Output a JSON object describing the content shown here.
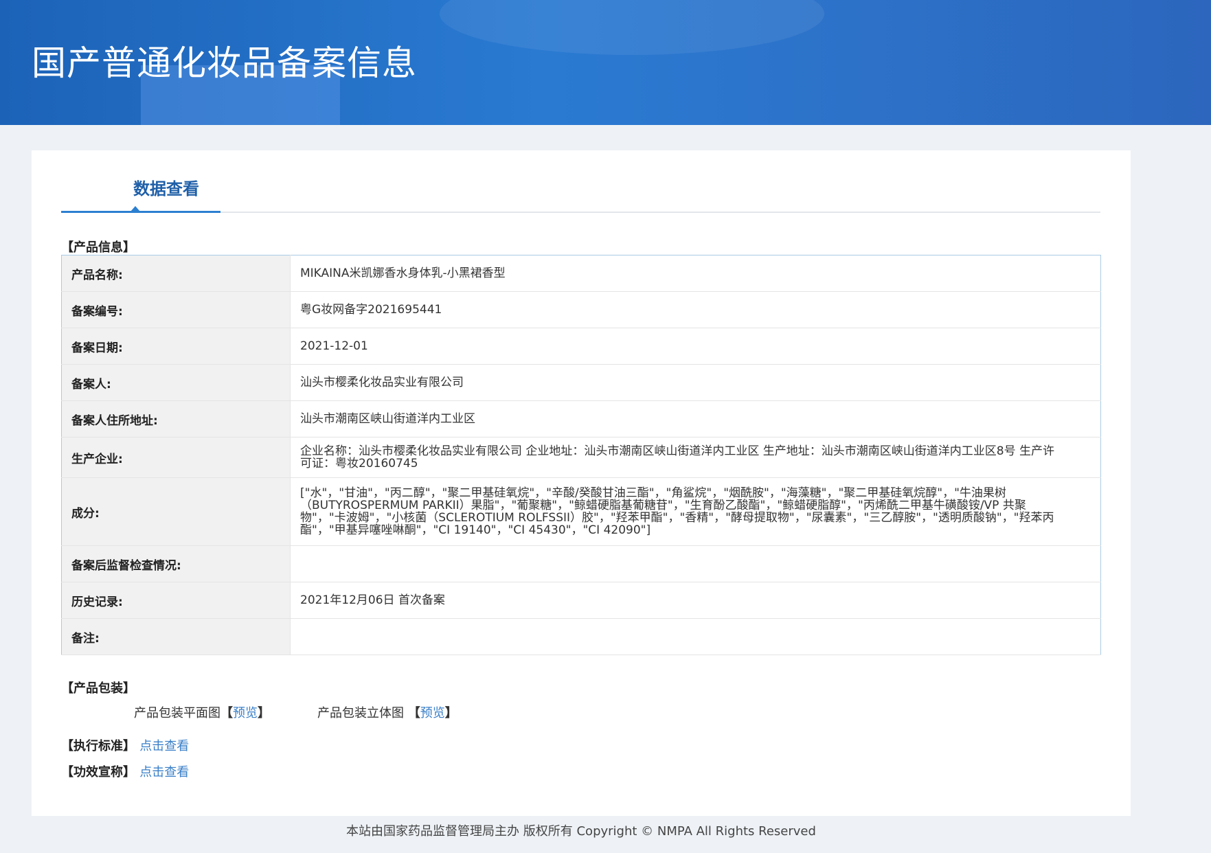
{
  "header": {
    "title": "国产普通化妆品备案信息"
  },
  "tab": {
    "label": "数据查看"
  },
  "product_info": {
    "section_title": "【产品信息】",
    "rows": [
      {
        "label": "产品名称:",
        "value": "MIKAINA米凯娜香水身体乳-小黑裙香型"
      },
      {
        "label": "备案编号:",
        "value": "粤G妆网备字2021695441"
      },
      {
        "label": "备案日期:",
        "value": "2021-12-01"
      },
      {
        "label": "备案人:",
        "value": "汕头市樱柔化妆品实业有限公司"
      },
      {
        "label": "备案人住所地址:",
        "value": "汕头市潮南区峡山街道洋内工业区"
      },
      {
        "label": "生产企业:",
        "value": "企业名称：汕头市樱柔化妆品实业有限公司 企业地址：汕头市潮南区峡山街道洋内工业区 生产地址：汕头市潮南区峡山街道洋内工业区8号 生产许可证：粤妆20160745"
      },
      {
        "label": "成分:",
        "value": "[\"水\"，\"甘油\"，\"丙二醇\"，\"聚二甲基硅氧烷\"，\"辛酸/癸酸甘油三酯\"，\"角鲨烷\"，\"烟酰胺\"，\"海藻糖\"，\"聚二甲基硅氧烷醇\"，\"牛油果树（BUTYROSPERMUM PARKII）果脂\"，\"葡聚糖\"，\"鲸蜡硬脂基葡糖苷\"，\"生育酚乙酸酯\"，\"鲸蜡硬脂醇\"，\"丙烯酰二甲基牛磺酸铵/VP 共聚物\"，\"卡波姆\"，\"小核菌（SCLEROTIUM ROLFSSII）胶\"，\"羟苯甲酯\"，\"香精\"，\"酵母提取物\"，\"尿囊素\"，\"三乙醇胺\"，\"透明质酸钠\"，\"羟苯丙酯\"，\"甲基异噻唑啉酮\"，\"CI 19140\"，\"CI 45430\"，\"CI 42090\"]"
      },
      {
        "label": "备案后监督检查情况:",
        "value": ""
      },
      {
        "label": "历史记录:",
        "value": "2021年12月06日 首次备案"
      },
      {
        "label": "备注:",
        "value": ""
      }
    ]
  },
  "packaging": {
    "section_title": "【产品包装】",
    "flat_label": "产品包装平面图",
    "flat_link": "预览",
    "stereo_label": "产品包装立体图",
    "stereo_link": "预览",
    "bracket_open": "【",
    "bracket_close": "】"
  },
  "standard": {
    "label": "【执行标准】",
    "link": "点击查看"
  },
  "efficacy": {
    "label": "【功效宣称】",
    "link": "点击查看"
  },
  "footer": {
    "text": "本站由国家药品监督管理局主办 版权所有 Copyright © NMPA All Rights Reserved"
  }
}
